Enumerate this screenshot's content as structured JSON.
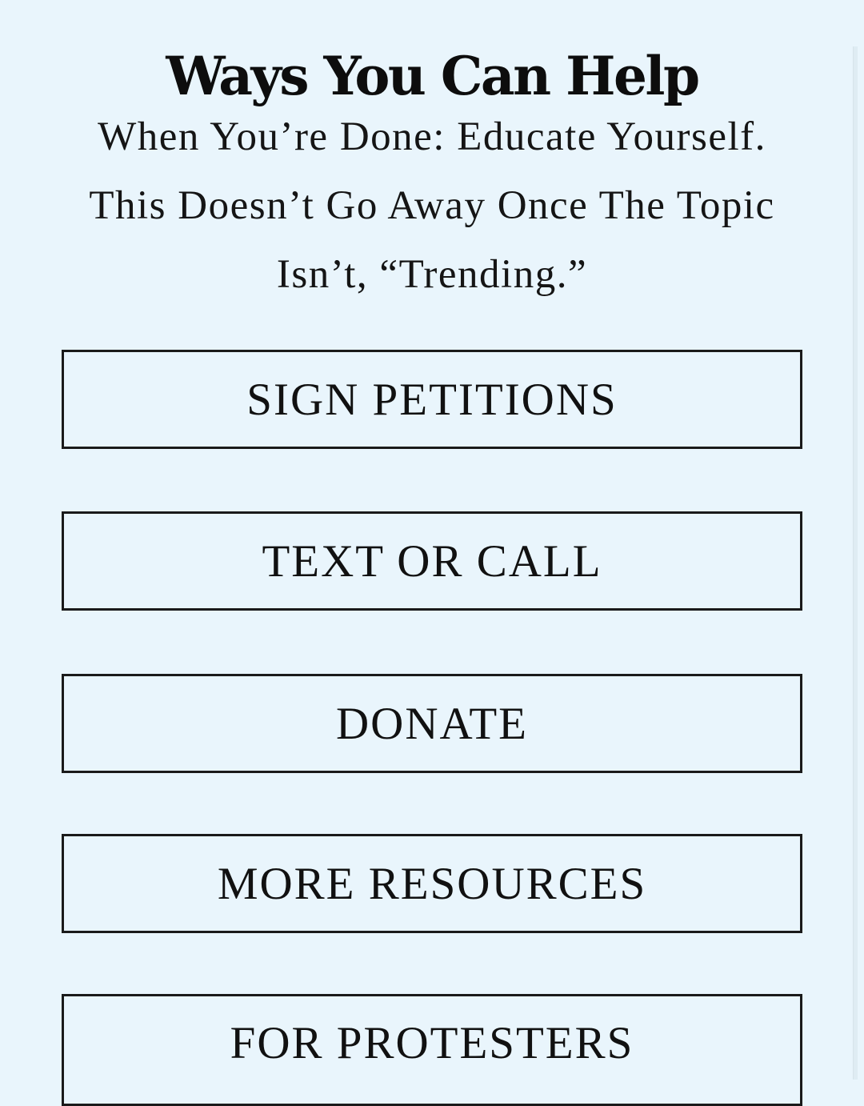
{
  "header": {
    "title": "Ways You Can Help"
  },
  "intro": {
    "lines": [
      "When You’re Done: Educate Yourself.",
      "This Doesn’t Go Away Once The Topic",
      "Isn’t, “Trending.”"
    ]
  },
  "actions": [
    {
      "label": "SIGN PETITIONS"
    },
    {
      "label": "TEXT OR CALL"
    },
    {
      "label": "DONATE"
    },
    {
      "label": "MORE RESOURCES"
    },
    {
      "label": "FOR PROTESTERS"
    }
  ],
  "colors": {
    "background": "#e9f5fc",
    "text": "#111111",
    "border": "#1a1a1a"
  }
}
